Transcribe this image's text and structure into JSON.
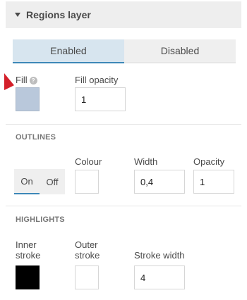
{
  "header": {
    "title": "Regions layer"
  },
  "toggle": {
    "enabled_label": "Enabled",
    "disabled_label": "Disabled",
    "selected": "Enabled"
  },
  "fill": {
    "label": "Fill",
    "help_icon": "?",
    "color": "#b9c8db",
    "opacity_label": "Fill opacity",
    "opacity_value": "1"
  },
  "outlines": {
    "section_title": "OUTLINES",
    "on_label": "On",
    "off_label": "Off",
    "selected": "On",
    "colour_label": "Colour",
    "colour_value": "#ffffff",
    "width_label": "Width",
    "width_value": "0,4",
    "opacity_label": "Opacity",
    "opacity_value": "1"
  },
  "highlights": {
    "section_title": "HIGHLIGHTS",
    "inner_label_line1": "Inner",
    "inner_label_line2": "stroke",
    "inner_color": "#000000",
    "outer_label_line1": "Outer",
    "outer_label_line2": "stroke",
    "outer_color": "#ffffff",
    "stroke_width_label": "Stroke width",
    "stroke_width_value": "4"
  },
  "colors": {
    "accent": "#3d88b8",
    "pointer": "#d4202a",
    "active_tab_bg": "#d7e5ef"
  }
}
